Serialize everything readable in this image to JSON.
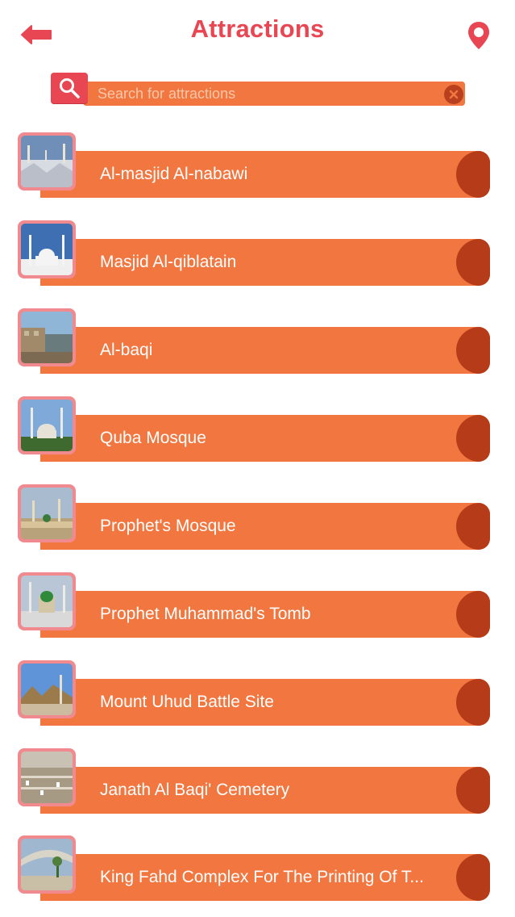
{
  "header": {
    "title": "Attractions",
    "back_icon": "back-arrow-icon",
    "location_icon": "map-pin-icon"
  },
  "search": {
    "placeholder": "Search for attractions",
    "value": "",
    "icon": "search-icon",
    "clear_icon": "clear-icon"
  },
  "colors": {
    "accent": "#e84652",
    "banner": "#f2763f",
    "banner_cap": "#b63c19",
    "thumb_border": "#f08a8e"
  },
  "attractions": [
    {
      "label": "Al-masjid Al-nabawi"
    },
    {
      "label": "Masjid Al-qiblatain"
    },
    {
      "label": "Al-baqi"
    },
    {
      "label": "Quba Mosque"
    },
    {
      "label": "Prophet's Mosque"
    },
    {
      "label": "Prophet Muhammad's Tomb"
    },
    {
      "label": "Mount Uhud Battle Site"
    },
    {
      "label": "Janath Al Baqi' Cemetery"
    },
    {
      "label": "King Fahd Complex For The Printing Of T..."
    }
  ]
}
